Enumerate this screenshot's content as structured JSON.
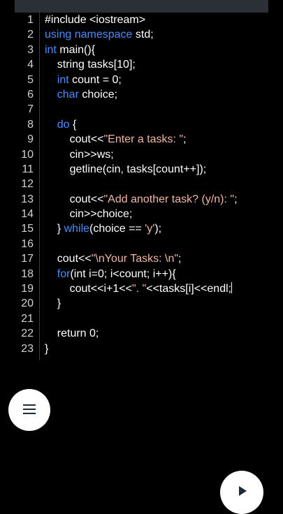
{
  "editor": {
    "lines": [
      {
        "num": "1",
        "segments": [
          {
            "t": "#include <iostream>",
            "c": "norm"
          }
        ]
      },
      {
        "num": "2",
        "segments": [
          {
            "t": "using namespace",
            "c": "kw"
          },
          {
            "t": " std;",
            "c": "norm"
          }
        ]
      },
      {
        "num": "3",
        "segments": [
          {
            "t": "int",
            "c": "kw"
          },
          {
            "t": " main(){",
            "c": "norm"
          }
        ]
      },
      {
        "num": "4",
        "segments": [
          {
            "t": "    string tasks[10];",
            "c": "norm"
          }
        ]
      },
      {
        "num": "5",
        "segments": [
          {
            "t": "    ",
            "c": "norm"
          },
          {
            "t": "int",
            "c": "kw"
          },
          {
            "t": " count = 0;",
            "c": "norm"
          }
        ]
      },
      {
        "num": "6",
        "segments": [
          {
            "t": "    ",
            "c": "norm"
          },
          {
            "t": "char",
            "c": "kw"
          },
          {
            "t": " choice;",
            "c": "norm"
          }
        ]
      },
      {
        "num": "7",
        "segments": [
          {
            "t": "",
            "c": "norm"
          }
        ]
      },
      {
        "num": "8",
        "segments": [
          {
            "t": "    ",
            "c": "norm"
          },
          {
            "t": "do",
            "c": "kw"
          },
          {
            "t": " {",
            "c": "norm"
          }
        ]
      },
      {
        "num": "9",
        "segments": [
          {
            "t": "        cout<<",
            "c": "norm"
          },
          {
            "t": "\"Enter a tasks: \"",
            "c": "str"
          },
          {
            "t": ";",
            "c": "norm"
          }
        ]
      },
      {
        "num": "10",
        "segments": [
          {
            "t": "        cin>>ws;",
            "c": "norm"
          }
        ]
      },
      {
        "num": "11",
        "segments": [
          {
            "t": "        getline(cin, tasks[count++]);",
            "c": "norm"
          }
        ]
      },
      {
        "num": "12",
        "segments": [
          {
            "t": "",
            "c": "norm"
          }
        ]
      },
      {
        "num": "13",
        "segments": [
          {
            "t": "        cout<<",
            "c": "norm"
          },
          {
            "t": "\"Add another task? (y/n): \"",
            "c": "str"
          },
          {
            "t": ";",
            "c": "norm"
          }
        ]
      },
      {
        "num": "14",
        "segments": [
          {
            "t": "        cin>>choice;",
            "c": "norm"
          }
        ]
      },
      {
        "num": "15",
        "segments": [
          {
            "t": "    } ",
            "c": "norm"
          },
          {
            "t": "while",
            "c": "kw"
          },
          {
            "t": "(choice == ",
            "c": "norm"
          },
          {
            "t": "'y'",
            "c": "str"
          },
          {
            "t": ");",
            "c": "norm"
          }
        ]
      },
      {
        "num": "16",
        "segments": [
          {
            "t": "",
            "c": "norm"
          }
        ]
      },
      {
        "num": "17",
        "segments": [
          {
            "t": "    cout<<",
            "c": "norm"
          },
          {
            "t": "\"\\nYour Tasks: \\n\"",
            "c": "str"
          },
          {
            "t": ";",
            "c": "norm"
          }
        ]
      },
      {
        "num": "18",
        "segments": [
          {
            "t": "    ",
            "c": "norm"
          },
          {
            "t": "for",
            "c": "kw"
          },
          {
            "t": "(int i=0; i<count; i++){",
            "c": "norm"
          }
        ]
      },
      {
        "num": "19",
        "segments": [
          {
            "t": "        cout<<i+1<<",
            "c": "norm"
          },
          {
            "t": "\". \"",
            "c": "str"
          },
          {
            "t": "<<tasks[i]<<endl;",
            "c": "norm"
          }
        ],
        "cursor": true
      },
      {
        "num": "20",
        "segments": [
          {
            "t": "    }",
            "c": "norm"
          }
        ]
      },
      {
        "num": "21",
        "segments": [
          {
            "t": "",
            "c": "norm"
          }
        ]
      },
      {
        "num": "22",
        "segments": [
          {
            "t": "    return 0;",
            "c": "norm"
          }
        ]
      },
      {
        "num": "23",
        "segments": [
          {
            "t": "}",
            "c": "norm"
          }
        ]
      }
    ]
  },
  "fabs": {
    "menu_icon": "hamburger-menu-icon",
    "run_icon": "play-icon"
  },
  "colors": {
    "background": "#000000",
    "keyword": "#4a8cff",
    "string": "#f0b6a6",
    "text": "#ffffff",
    "line_number": "#cfd2d6"
  }
}
